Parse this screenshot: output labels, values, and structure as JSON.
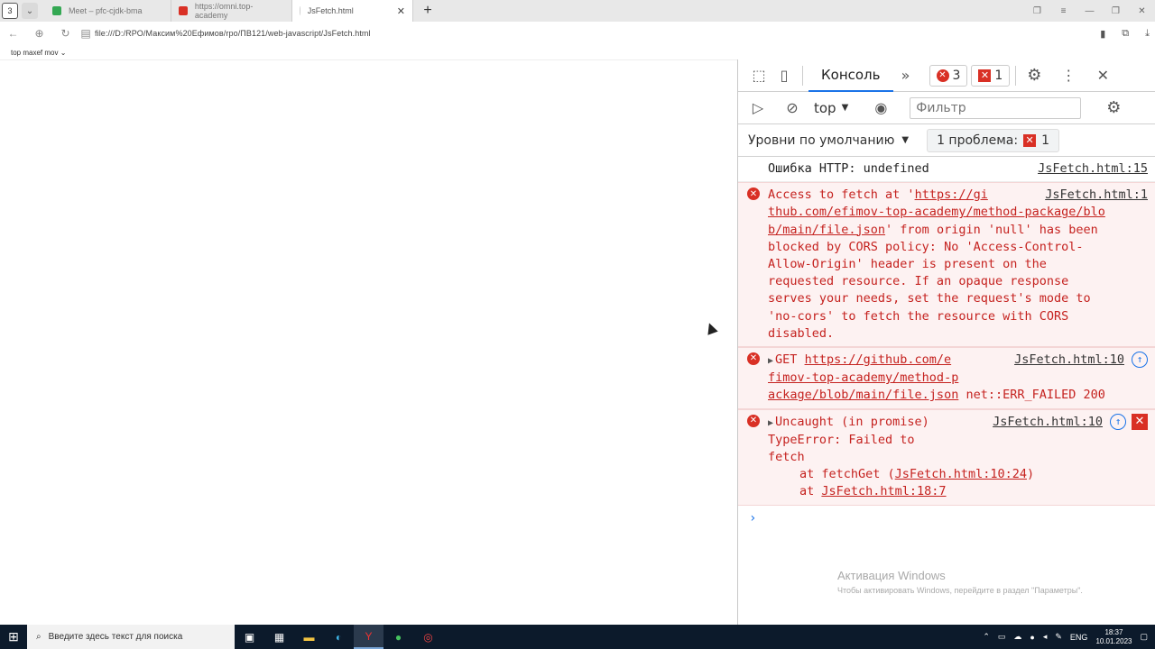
{
  "browser": {
    "tab_counter": "3",
    "tabs": [
      {
        "label": "Meet – pfc-cjdk-bma",
        "color": "#34a853"
      },
      {
        "label": "https://omni.top-academy",
        "color": "#d93025"
      },
      {
        "label": "JsFetch.html",
        "color": "#bbbbbb"
      }
    ],
    "url": "file:///D:/RPO/Максим%20Ефимов/rpo/ПВ121/web-javascript/JsFetch.html",
    "page_header": "top maxef mov ⌄"
  },
  "devtools": {
    "active_tab": "Консоль",
    "errors_badge": "3",
    "issues_badge": "1",
    "context": "top",
    "filter_placeholder": "Фильтр",
    "levels": "Уровни по умолчанию",
    "issues_label": "1 проблема:",
    "issues_count": "1",
    "messages": {
      "m1": {
        "text": "Ошибка HTTP: undefined",
        "src": "JsFetch.html:15"
      },
      "m2": {
        "prefix": "Access to fetch at '",
        "url1": "https://gi",
        "src": "JsFetch.html:1",
        "url2": "thub.com/efimov-top-academy/method-package/blo",
        "url3": "b/main/file.json",
        "rest1": "' from origin 'null' has been",
        "rest2": "blocked by CORS policy: No 'Access-Control-",
        "rest3": "Allow-Origin' header is present on the",
        "rest4": "requested resource. If an opaque response",
        "rest5": "serves your needs, set the request's mode to",
        "rest6": "'no-cors' to fetch the resource with CORS",
        "rest7": "disabled."
      },
      "m3": {
        "method": "GET",
        "url1": "https://github.com/e",
        "src": "JsFetch.html:10",
        "url2": "fimov-top-academy/method-p",
        "url3": "ackage/blob/main/file.json",
        "status": "net::ERR_FAILED 200"
      },
      "m4": {
        "head": "Uncaught (in promise)",
        "src": "JsFetch.html:10",
        "l1": "TypeError: Failed to",
        "l2": "fetch",
        "l3a": "at fetchGet (",
        "l3b": "JsFetch.html:10:24",
        "l3c": ")",
        "l4a": "at ",
        "l4b": "JsFetch.html:18:7"
      }
    },
    "prompt": "›"
  },
  "activation": {
    "title": "Активация Windows",
    "subtitle": "Чтобы активировать Windows, перейдите в раздел \"Параметры\"."
  },
  "taskbar": {
    "search_placeholder": "Введите здесь текст для поиска",
    "lang": "ENG",
    "time": "18:37",
    "date": "10.01.2023"
  }
}
